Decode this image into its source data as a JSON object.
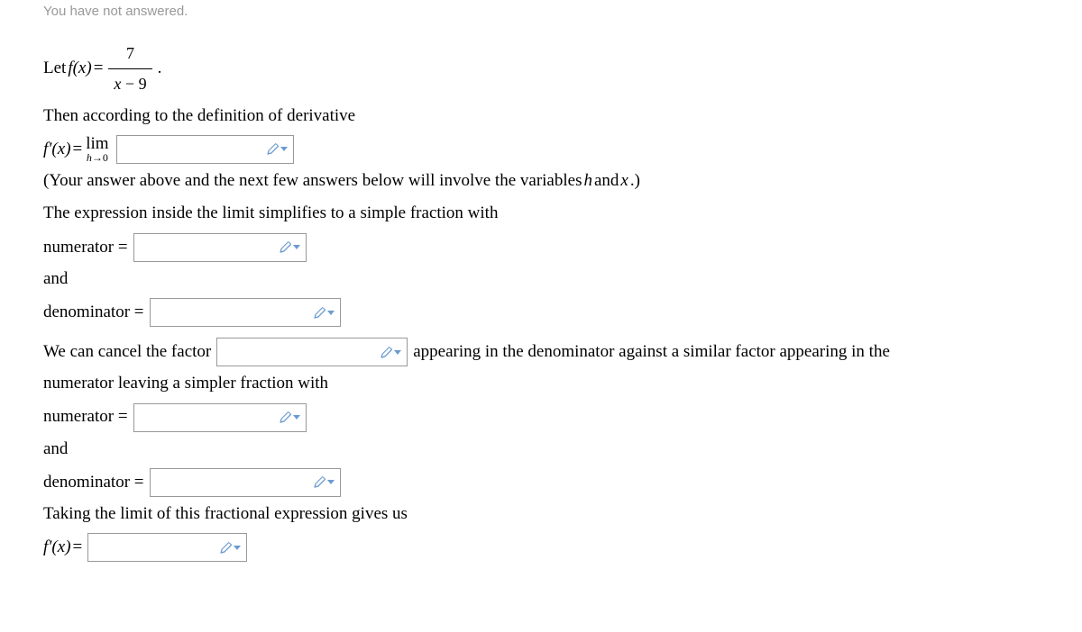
{
  "status": "You have not answered.",
  "problem": {
    "let_prefix": "Let ",
    "fx_label": "f(x)",
    "equals": " = ",
    "frac_num": "7",
    "frac_den_x": "x",
    "frac_den_minus": " − ",
    "frac_den_num": "9",
    "period": ".",
    "then_text": "Then according to the definition of derivative",
    "fprime_label": "f′(x)",
    "lim_text": "lim",
    "lim_sub_h": "h",
    "lim_sub_arrow": "→0",
    "hint1_a": "(Your answer above and the next few answers below will involve the variables ",
    "hint1_h": "h",
    "hint1_b": " and ",
    "hint1_x": "x",
    "hint1_c": ".)",
    "simplify_text": "The expression inside the limit simplifies to a simple fraction with",
    "numerator_label": "numerator = ",
    "and_label": "and",
    "denominator_label": "denominator = ",
    "cancel_a": "We can cancel the factor ",
    "cancel_b": " appearing in the denominator against a similar factor appearing in the",
    "cancel_c": "numerator leaving a simpler fraction with",
    "taking_limit": "Taking the limit of this fractional expression gives us"
  }
}
